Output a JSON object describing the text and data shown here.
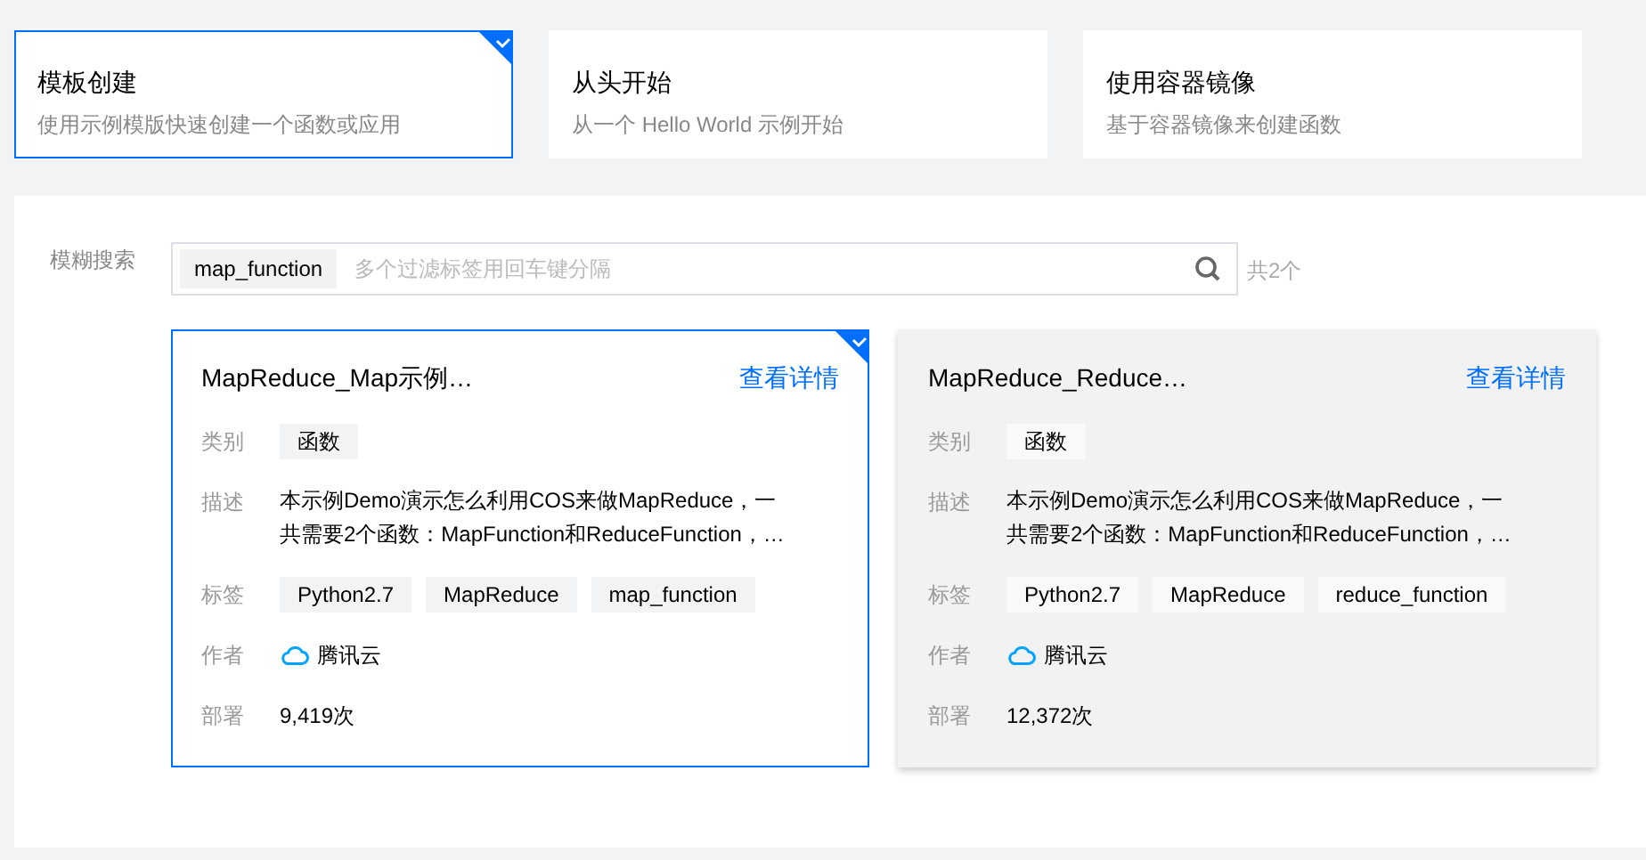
{
  "modes": [
    {
      "title": "模板创建",
      "subtitle": "使用示例模版快速创建一个函数或应用",
      "selected": true
    },
    {
      "title": "从头开始",
      "subtitle": "从一个 Hello World 示例开始",
      "selected": false
    },
    {
      "title": "使用容器镜像",
      "subtitle": "基于容器镜像来创建函数",
      "selected": false
    }
  ],
  "search": {
    "label": "模糊搜索",
    "tags": [
      "map_function"
    ],
    "placeholder": "多个过滤标签用回车键分隔",
    "count": "共2个"
  },
  "templates": [
    {
      "title": "MapReduce_Map示例…",
      "link": "查看详情",
      "selected": true,
      "hovered": false,
      "fields": [
        {
          "kind": "tags",
          "label": "类别",
          "tags": [
            "函数"
          ]
        },
        {
          "kind": "lines",
          "label": "描述",
          "lines": [
            "本示例Demo演示怎么利用COS来做MapReduce，一",
            "共需要2个函数：MapFunction和ReduceFunction，…"
          ]
        },
        {
          "kind": "tags",
          "label": "标签",
          "tags": [
            "Python2.7",
            "MapReduce",
            "map_function"
          ]
        },
        {
          "kind": "author",
          "label": "作者",
          "value": "腾讯云"
        },
        {
          "kind": "text",
          "label": "部署",
          "value": "9,419次"
        }
      ]
    },
    {
      "title": "MapReduce_Reduce…",
      "link": "查看详情",
      "selected": false,
      "hovered": true,
      "fields": [
        {
          "kind": "tags",
          "label": "类别",
          "tags": [
            "函数"
          ]
        },
        {
          "kind": "lines",
          "label": "描述",
          "lines": [
            "本示例Demo演示怎么利用COS来做MapReduce，一",
            "共需要2个函数：MapFunction和ReduceFunction，…"
          ]
        },
        {
          "kind": "tags",
          "label": "标签",
          "tags": [
            "Python2.7",
            "MapReduce",
            "reduce_function"
          ]
        },
        {
          "kind": "author",
          "label": "作者",
          "value": "腾讯云"
        },
        {
          "kind": "text",
          "label": "部署",
          "value": "12,372次"
        }
      ]
    }
  ]
}
